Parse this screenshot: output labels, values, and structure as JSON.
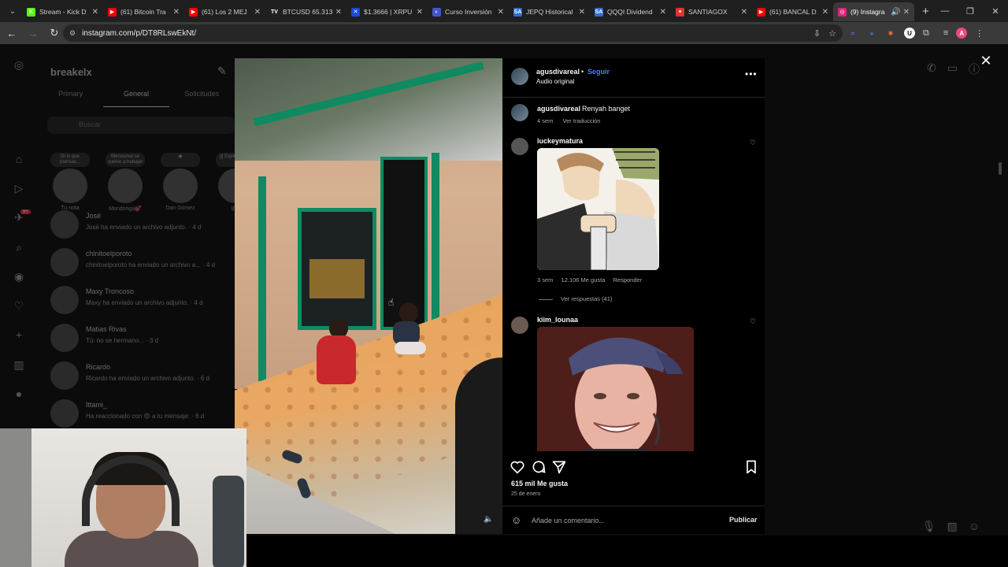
{
  "browser": {
    "tabs": [
      {
        "title": "Stream - Kick D",
        "favicon_color": "#53fc18",
        "favicon_glyph": "K",
        "active": false
      },
      {
        "title": "(61) Bitcoin Tra",
        "favicon_color": "#ff0000",
        "favicon_glyph": "▶",
        "active": false
      },
      {
        "title": "(61) Los 2 MEJ",
        "favicon_color": "#ff0000",
        "favicon_glyph": "▶",
        "active": false
      },
      {
        "title": "BTCUSD 65.313",
        "favicon_color": "#222222",
        "favicon_glyph": "TV",
        "active": false
      },
      {
        "title": "$1.3666 | XRPU",
        "favicon_color": "#1e4bd8",
        "favicon_glyph": "✕",
        "active": false
      },
      {
        "title": "Curso Inversión",
        "favicon_color": "#4455cc",
        "favicon_glyph": "◐",
        "active": false
      },
      {
        "title": "JEPQ Historical",
        "favicon_color": "#2f6fd1",
        "favicon_glyph": "SA",
        "active": false
      },
      {
        "title": "QQQI Dividend",
        "favicon_color": "#2f6fd1",
        "favicon_glyph": "SA",
        "active": false
      },
      {
        "title": "SANTIAGOX",
        "favicon_color": "#e0322e",
        "favicon_glyph": "✦",
        "active": false
      },
      {
        "title": "(61) BANCAL D",
        "favicon_color": "#ff0000",
        "favicon_glyph": "▶",
        "active": false
      },
      {
        "title": "(9) Instagra",
        "favicon_color": "#d62976",
        "favicon_glyph": "◎",
        "active": true
      }
    ],
    "url": "instagram.com/p/DT8RLswEkNt/"
  },
  "instagram_bg": {
    "account": "breakelx",
    "tabs": [
      "Primary",
      "General",
      "Solicitudes"
    ],
    "active_tab": "General",
    "search_placeholder": "Buscar",
    "notes": [
      {
        "bubble": "Di lo que piensas...",
        "name": "Tu nota"
      },
      {
        "bubble": "Menosmal se vuelve a trabajar",
        "name": "Mondonga💕"
      },
      {
        "bubble": "◆",
        "name": "Dan Gómez"
      },
      {
        "bubble": "||| Explo Shade",
        "name": "gus"
      }
    ],
    "conversations": [
      {
        "name": "José",
        "message": "José ha enviado un archivo adjunto. · 4 d"
      },
      {
        "name": "chinitoelporoto",
        "message": "chinitoelporoto ha enviado un archivo a... · 4 d"
      },
      {
        "name": "Maxy Troncoso",
        "message": "Maxy ha enviado un archivo adjunto. · 4 d"
      },
      {
        "name": "Matias Rivas",
        "message": "Tú: no se hermano... · 3 d"
      },
      {
        "name": "Ricardo",
        "message": "Ricardo ha enviado un archivo adjunto. · 6 d"
      },
      {
        "name": "Ittami_",
        "message": "Ha reaccionado con 😡 a tu mensaje: · 6 d"
      }
    ],
    "notification_badge": "9+"
  },
  "post": {
    "author": "agusdivareal",
    "follow_label": "Seguir",
    "separator": "•",
    "audio": "Audio original",
    "caption_user": "agusdivareal",
    "caption_text": "Renyah banget",
    "caption_age": "4 sem",
    "translate_label": "Ver traducción",
    "comments": [
      {
        "user": "luckeymatura",
        "age": "3 sem",
        "likes": "12.106 Me gusta",
        "reply_label": "Responder",
        "replies_label": "Ver respuestas (41)"
      },
      {
        "user": "kiim_lounaa"
      }
    ],
    "likes": "615 mil Me gusta",
    "date": "25 de enero",
    "comment_placeholder": "Añade un comentario...",
    "publish_label": "Publicar"
  }
}
